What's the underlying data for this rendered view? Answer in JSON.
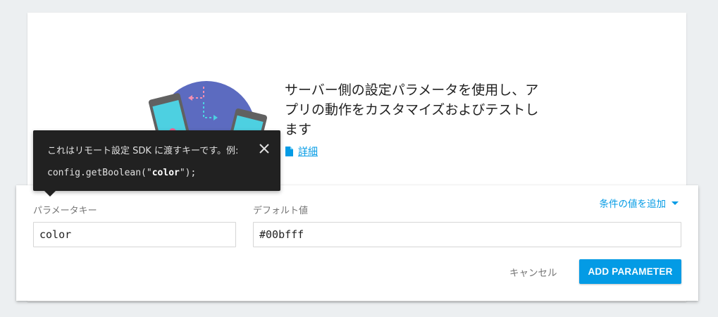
{
  "hero": {
    "line1": "サーバー側の設定パラメータを使用し、ア",
    "line2": "プリの動作をカスタマイズおよびテストし",
    "line3": "ます",
    "learn_more": "詳細"
  },
  "tooltip": {
    "text": "これはリモート設定 SDK に渡すキーです。例:",
    "code_prefix": "config.getBoolean(\"",
    "code_key": "color",
    "code_suffix": "\");"
  },
  "form": {
    "key_label": "パラメータキー",
    "key_value": "color",
    "default_label": "デフォルト値",
    "default_value": "#00bfff",
    "add_condition": "条件の値を追加",
    "cancel": "キャンセル",
    "add_parameter": "ADD PARAMETER"
  },
  "icons": {
    "doc": "document-icon",
    "close": "close-icon",
    "dropdown": "triangle-down-icon"
  },
  "colors": {
    "accent": "#039be5",
    "tooltip_bg": "#212121",
    "illustration_circle": "#5c6bc0",
    "phone_screen": "#4dd0e1"
  }
}
